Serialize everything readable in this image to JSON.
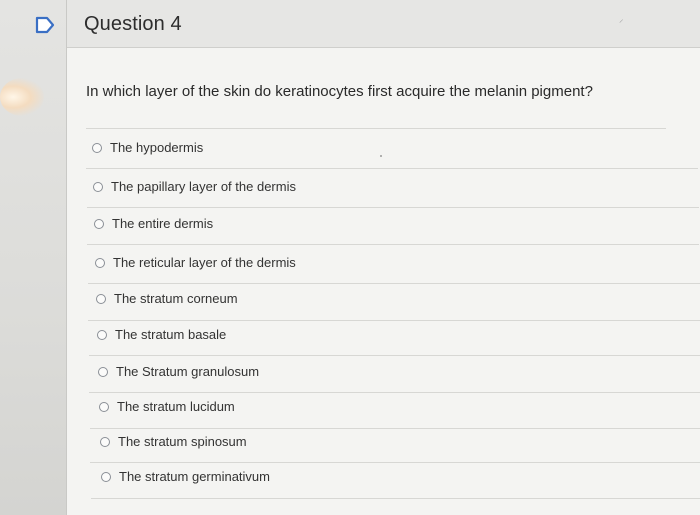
{
  "header": {
    "title": "Question 4"
  },
  "question": {
    "text": "In which layer of the skin do keratinocytes first acquire the melanin pigment?"
  },
  "options": [
    {
      "label": "The hypodermis"
    },
    {
      "label": "The papillary layer of the dermis"
    },
    {
      "label": "The entire dermis"
    },
    {
      "label": "The reticular layer of the dermis"
    },
    {
      "label": "The stratum corneum"
    },
    {
      "label": "The stratum basale"
    },
    {
      "label": "The Stratum granulosum"
    },
    {
      "label": "The stratum lucidum"
    },
    {
      "label": "The stratum spinosum"
    },
    {
      "label": "The stratum germinativum"
    }
  ],
  "colors": {
    "flag": "#3a6fc4",
    "card_background": "#f4f4f2",
    "header_background": "#e6e6e4"
  },
  "icons": {
    "flag": "flag-icon",
    "radio": "radio-empty-icon"
  }
}
